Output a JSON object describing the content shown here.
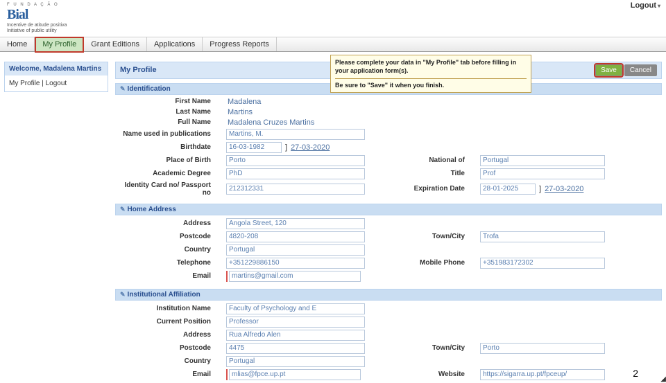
{
  "header": {
    "logo_sub": "F U N D A Ç Ã O",
    "logo_main": "Bial",
    "logo_tag1": "Incentive de atitude positiva",
    "logo_tag2": "Initiative of public utility",
    "logout": "Logout"
  },
  "nav": {
    "home": "Home",
    "profile": "My Profile",
    "grants": "Grant Editions",
    "apps": "Applications",
    "reports": "Progress Reports"
  },
  "sidebar": {
    "welcome": "Welcome, Madalena Martins",
    "my_profile": "My Profile",
    "sep": " | ",
    "logout": "Logout"
  },
  "page": {
    "title": "My Profile",
    "save": "Save",
    "cancel": "Cancel"
  },
  "callout": {
    "line1": "Please complete your data in \"My Profile\" tab before filling in your application form(s).",
    "line2": "Be sure to \"Save\" it when you finish."
  },
  "sections": {
    "ident": "Identification",
    "home": "Home Address",
    "inst": "Institutional Affiliation"
  },
  "labels": {
    "first_name": "First Name",
    "last_name": "Last Name",
    "full_name": "Full Name",
    "pub_name": "Name used in publications",
    "birthdate": "Birthdate",
    "place_birth": "Place of Birth",
    "national": "National of",
    "academic": "Academic Degree",
    "title": "Title",
    "idcard": "Identity Card no/ Passport no",
    "expdate": "Expiration Date",
    "address": "Address",
    "postcode": "Postcode",
    "town": "Town/City",
    "country": "Country",
    "telephone": "Telephone",
    "mobile": "Mobile Phone",
    "email": "Email",
    "inst_name": "Institution Name",
    "cur_pos": "Current Position",
    "website": "Website"
  },
  "values": {
    "first_name": "Madalena",
    "last_name": "Martins",
    "full_name": "Madalena Cruzes Martins",
    "pub_name": "Martins, M.",
    "birthdate": "16-03-1982",
    "date_today": "27-03-2020",
    "place_birth": "Porto",
    "national": "Portugal",
    "academic": "PhD",
    "title": "Prof",
    "idcard": "212312331",
    "expdate": "28-01-2025",
    "h_address": "Angola Street, 120",
    "h_postcode": "4820-208",
    "h_town": "Trofa",
    "h_country": "Portugal",
    "h_tel": "+351229886150",
    "h_mobile": "+351983172302",
    "h_email": "martins@gmail.com",
    "i_name": "Faculty of Psychology and E",
    "i_pos": "Professor",
    "i_address": "Rua Alfredo Alen",
    "i_postcode": "4475",
    "i_town": "Porto",
    "i_country": "Portugal",
    "i_email": "mlias@fpce.up.pt",
    "i_website": "https://sigarra.up.pt/fpceup/"
  },
  "page_num": "2"
}
